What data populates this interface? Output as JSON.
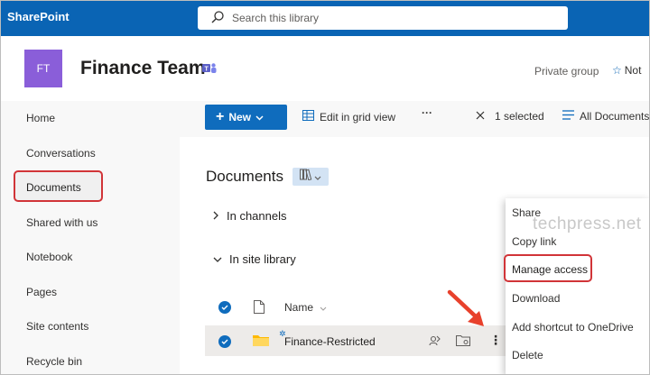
{
  "topbar": {
    "brand": "SharePoint",
    "search_placeholder": "Search this library",
    "search_icon": "search-icon"
  },
  "site": {
    "logo_initials": "FT",
    "title": "Finance Team",
    "privacy": "Private group",
    "follow_label": "Not"
  },
  "nav": {
    "items": [
      "Home",
      "Conversations",
      "Documents",
      "Shared with us",
      "Notebook",
      "Pages",
      "Site contents",
      "Recycle bin"
    ],
    "selected": "Documents"
  },
  "commands": {
    "new_label": "New",
    "edit_grid": "Edit in grid view",
    "more": "···",
    "selected_count": "1 selected",
    "all_documents": "All Documents"
  },
  "library": {
    "title": "Documents",
    "groups": [
      "In channels",
      "In site library"
    ],
    "column_name": "Name",
    "file_name": "Finance-Restricted"
  },
  "context_menu": {
    "items": [
      "Share",
      "Copy link",
      "Manage access",
      "Download",
      "Add shortcut to OneDrive",
      "Delete"
    ],
    "highlighted": "Manage access"
  },
  "watermark": "techpress.net",
  "colors": {
    "topbar": "#0a64b4",
    "accent": "#0f6cbd",
    "logo": "#8a5ed9",
    "highlight": "#d13438"
  }
}
